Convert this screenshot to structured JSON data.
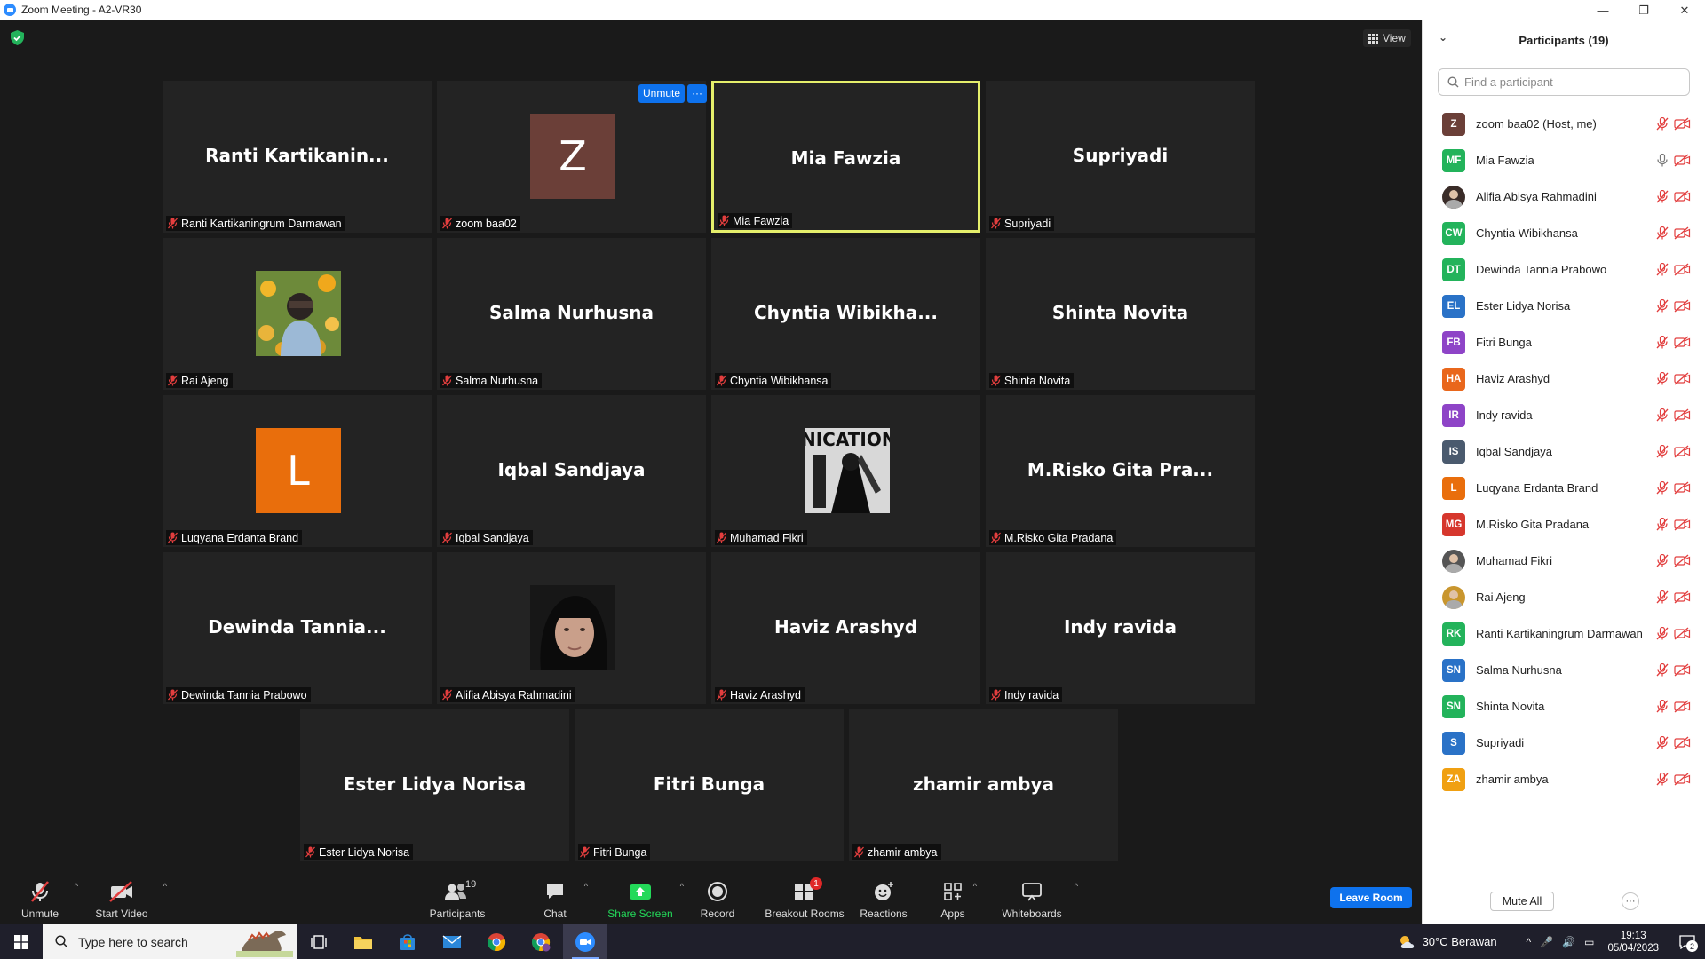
{
  "window": {
    "title": "Zoom Meeting - A2-VR30"
  },
  "meeting": {
    "view_label": "View",
    "unmute_pill": {
      "unmute_label": "Unmute",
      "more_label": "···"
    },
    "tiles": [
      {
        "big": "Ranti  Kartikanin...",
        "label": "Ranti Kartikaningrum Darmawan"
      },
      {
        "big": "",
        "label": "zoom baa02",
        "avatar_letter": "Z",
        "avatar_color": "#6b3f38"
      },
      {
        "big": "Mia Fawzia",
        "label": "Mia Fawzia",
        "active": true,
        "speaking": true
      },
      {
        "big": "Supriyadi",
        "label": "Supriyadi"
      },
      {
        "big": "",
        "label": "Rai Ajeng",
        "photo": "flower-photo"
      },
      {
        "big": "Salma Nurhusna",
        "label": "Salma Nurhusna"
      },
      {
        "big": "Chyntia  Wibikha...",
        "label": "Chyntia Wibikhansa"
      },
      {
        "big": "Shinta  Novita",
        "label": "Shinta  Novita"
      },
      {
        "big": "",
        "label": "Luqyana Erdanta Brand",
        "avatar_letter": "L",
        "avatar_color": "#e96e0c"
      },
      {
        "big": "Iqbal Sandjaya",
        "label": "Iqbal Sandjaya"
      },
      {
        "big": "",
        "label": "Muhamad Fikri",
        "photo": "bw-photo"
      },
      {
        "big": "M.Risko Gita Pra...",
        "label": "M.Risko Gita Pradana"
      },
      {
        "big": "Dewinda  Tannia...",
        "label": "Dewinda Tannia Prabowo"
      },
      {
        "big": "",
        "label": "Alifia Abisya Rahmadini",
        "photo": "hijab-photo"
      },
      {
        "big": "Haviz Arashyd",
        "label": "Haviz Arashyd"
      },
      {
        "big": "Indy ravida",
        "label": "Indy ravida"
      },
      {
        "big": "Ester Lidya Norisa",
        "label": "Ester Lidya Norisa"
      },
      {
        "big": "Fitri Bunga",
        "label": "Fitri Bunga"
      },
      {
        "big": "zhamir ambya",
        "label": "zhamir ambya"
      }
    ]
  },
  "toolbar": {
    "unmute": "Unmute",
    "start_video": "Start Video",
    "participants": "Participants",
    "participants_count": "19",
    "chat": "Chat",
    "share_screen": "Share Screen",
    "record": "Record",
    "breakout_rooms": "Breakout Rooms",
    "breakout_badge": "1",
    "reactions": "Reactions",
    "apps": "Apps",
    "whiteboards": "Whiteboards",
    "leave_room": "Leave Room",
    "share_color": "#23d959",
    "leave_color": "#0e72ed"
  },
  "panel": {
    "title": "Participants (19)",
    "search_placeholder": "Find a participant",
    "mute_all": "Mute All",
    "more": "···",
    "participants": [
      {
        "initials": "Z",
        "color": "#6b3f38",
        "name": "zoom baa02 (Host, me)",
        "mic": "muted"
      },
      {
        "initials": "MF",
        "color": "#23b35b",
        "name": "Mia Fawzia",
        "mic": "on"
      },
      {
        "initials": "",
        "color": "#3a2c28",
        "name": "Alifia Abisya Rahmadini",
        "mic": "muted",
        "photo": true
      },
      {
        "initials": "CW",
        "color": "#23b35b",
        "name": "Chyntia Wibikhansa",
        "mic": "muted"
      },
      {
        "initials": "DT",
        "color": "#23b35b",
        "name": "Dewinda Tannia Prabowo",
        "mic": "muted"
      },
      {
        "initials": "EL",
        "color": "#2a72c7",
        "name": "Ester Lidya Norisa",
        "mic": "muted"
      },
      {
        "initials": "FB",
        "color": "#8e44c7",
        "name": "Fitri Bunga",
        "mic": "muted"
      },
      {
        "initials": "HA",
        "color": "#e9671c",
        "name": "Haviz Arashyd",
        "mic": "muted"
      },
      {
        "initials": "IR",
        "color": "#8e44c7",
        "name": "Indy ravida",
        "mic": "muted"
      },
      {
        "initials": "IS",
        "color": "#4a5a6e",
        "name": "Iqbal Sandjaya",
        "mic": "muted"
      },
      {
        "initials": "L",
        "color": "#e96e0c",
        "name": "Luqyana Erdanta Brand",
        "mic": "muted"
      },
      {
        "initials": "MG",
        "color": "#d6372d",
        "name": "M.Risko Gita Pradana",
        "mic": "muted"
      },
      {
        "initials": "",
        "color": "#555555",
        "name": "Muhamad Fikri",
        "mic": "muted",
        "photo": true
      },
      {
        "initials": "",
        "color": "#c9962e",
        "name": "Rai Ajeng",
        "mic": "muted",
        "photo": true
      },
      {
        "initials": "RK",
        "color": "#23b35b",
        "name": "Ranti Kartikaningrum Darmawan",
        "mic": "muted"
      },
      {
        "initials": "SN",
        "color": "#2a72c7",
        "name": "Salma Nurhusna",
        "mic": "muted"
      },
      {
        "initials": "SN",
        "color": "#23b35b",
        "name": "Shinta  Novita",
        "mic": "muted"
      },
      {
        "initials": "S",
        "color": "#2a72c7",
        "name": "Supriyadi",
        "mic": "muted"
      },
      {
        "initials": "ZA",
        "color": "#f0a012",
        "name": "zhamir ambya",
        "mic": "muted"
      }
    ]
  },
  "taskbar": {
    "search_placeholder": "Type here to search",
    "weather": "30°C  Berawan",
    "time": "19:13",
    "date": "05/04/2023",
    "notification_count": "2"
  }
}
